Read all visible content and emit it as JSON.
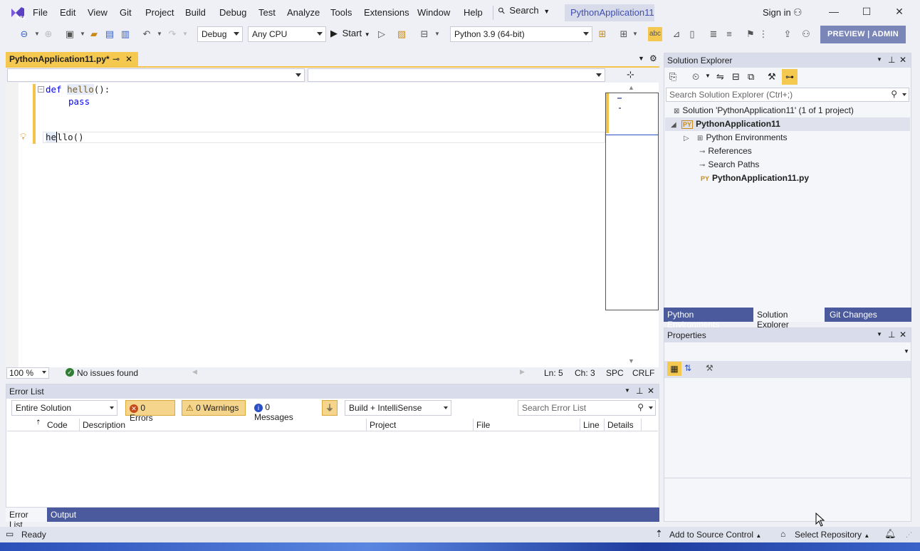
{
  "menu": {
    "items": [
      "File",
      "Edit",
      "View",
      "Git",
      "Project",
      "Build",
      "Debug",
      "Test",
      "Analyze",
      "Tools",
      "Extensions",
      "Window",
      "Help"
    ],
    "search_label": "Search",
    "project_title": "PythonApplication11",
    "sign_in": "Sign in"
  },
  "toolbar": {
    "config": "Debug",
    "platform": "Any CPU",
    "start": "Start",
    "environment": "Python 3.9 (64-bit)",
    "preview_admin": "PREVIEW | ADMIN"
  },
  "editor": {
    "tab_label": "PythonApplication11.py*",
    "lines": {
      "l1_kw": "def",
      "l1_fn": "hello",
      "l1_rest": "():",
      "l2": "pass",
      "l5_a": "he",
      "l5_b": "llo()"
    },
    "zoom": "100 %",
    "issues": "No issues found",
    "ln": "Ln: 5",
    "ch": "Ch: 3",
    "spc": "SPC",
    "crlf": "CRLF"
  },
  "solution_explorer": {
    "title": "Solution Explorer",
    "search_placeholder": "Search Solution Explorer (Ctrl+;)",
    "solution": "Solution 'PythonApplication11' (1 of 1 project)",
    "project": "PythonApplication11",
    "items": [
      "Python Environments",
      "References",
      "Search Paths"
    ],
    "file": "PythonApplication11.py",
    "tabs": [
      "Python Environments",
      "Solution Explorer",
      "Git Changes"
    ]
  },
  "properties": {
    "title": "Properties"
  },
  "error_list": {
    "title": "Error List",
    "scope": "Entire Solution",
    "errors": "0 Errors",
    "warnings": "0 Warnings",
    "messages": "0 Messages",
    "build_filter": "Build + IntelliSense",
    "search_placeholder": "Search Error List",
    "columns": [
      "Code",
      "Description",
      "Project",
      "File",
      "Line",
      "Details"
    ],
    "tabs": [
      "Error List",
      "Output"
    ]
  },
  "statusbar": {
    "ready": "Ready",
    "add_source_control": "Add to Source Control",
    "select_repo": "Select Repository"
  },
  "colors": {
    "accent_blue": "#3f4fb0",
    "tab_yellow": "#f5c94f",
    "panel_tab_bg": "#4a5a9c"
  }
}
